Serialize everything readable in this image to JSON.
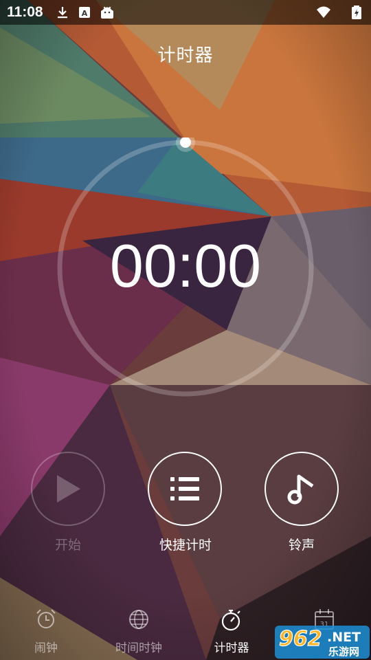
{
  "status_bar": {
    "time": "11:08",
    "icons": [
      "download-icon",
      "a-notification-icon",
      "android-icon",
      "wifi-icon",
      "battery-icon"
    ]
  },
  "page": {
    "title": "计时器"
  },
  "timer": {
    "display": "00:00"
  },
  "actions": [
    {
      "name": "start",
      "label": "开始",
      "icon": "play-icon",
      "enabled": false
    },
    {
      "name": "quick-timer",
      "label": "快捷计时",
      "icon": "list-icon",
      "enabled": true
    },
    {
      "name": "ringtone",
      "label": "铃声",
      "icon": "music-note-icon",
      "enabled": true
    }
  ],
  "bottom_nav": [
    {
      "name": "alarm",
      "label": "闹钟",
      "icon": "alarm-clock-icon",
      "active": false
    },
    {
      "name": "world-clock",
      "label": "时间时钟",
      "icon": "globe-icon",
      "active": false
    },
    {
      "name": "timer",
      "label": "计时器",
      "icon": "stopwatch-icon",
      "active": true
    },
    {
      "name": "calendar",
      "label": "",
      "icon": "calendar-icon",
      "active": false
    }
  ],
  "watermark": {
    "number": "962",
    "suffix": ".NET",
    "subtitle": "乐游网"
  },
  "colors": {
    "active": "#ffffff",
    "inactive": "rgba(255,255,255,0.55)",
    "disabled": "rgba(255,255,255,0.3)"
  }
}
